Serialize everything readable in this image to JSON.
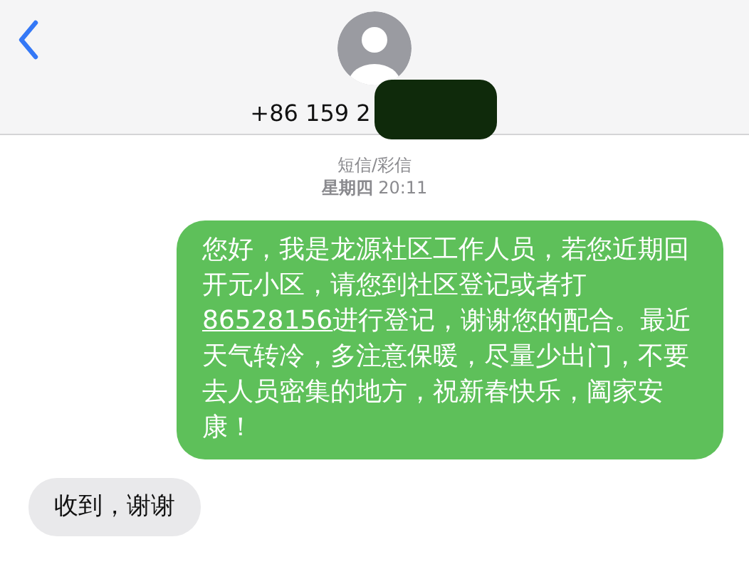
{
  "header": {
    "contact": "+86 159 2"
  },
  "thread": {
    "service": "短信/彩信",
    "timestamp": "**星期四** 20:11"
  },
  "messages": [
    {
      "kind": "sent",
      "parts": [
        {
          "kind": "text",
          "text": "您好，我是龙源社区工作人员，若您近期回开元小区，请您到社区登记或者打"
        },
        {
          "kind": "link",
          "text": "86528156"
        },
        {
          "kind": "text",
          "text": "进行登记，谢谢您的配合。最近天气转冷，多注意保暖，尽量少出门，不要去人员密集的地方，祝新春快乐，阖家安康！"
        }
      ]
    },
    {
      "kind": "received",
      "parts": [
        {
          "kind": "text",
          "text": "收到，谢谢"
        }
      ]
    }
  ]
}
